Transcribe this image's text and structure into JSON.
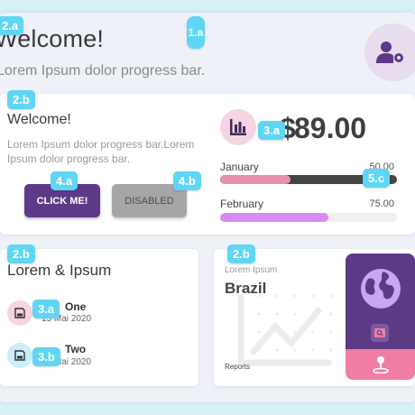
{
  "header": {
    "title": "Welcome!",
    "subtitle": "Lorem Ipsum dolor progress bar.",
    "settings_icon": "user-settings-icon"
  },
  "hero_card": {
    "title": "Welcome!",
    "text": "Lorem Ipsum dolor progress bar.Lorem Ipsum dolor progress bar.",
    "primary_button": "CLICK ME!",
    "disabled_button": "DISABLED"
  },
  "stats": {
    "icon": "bar-chart-icon",
    "amount_prefix": "$",
    "amount": "89.00",
    "bars": [
      {
        "label": "January",
        "value": "50.00",
        "fill": 0.4,
        "color": "#e890ab"
      },
      {
        "label": "February",
        "value": "75.00",
        "fill": 0.61,
        "color": "#d98af0"
      }
    ]
  },
  "list_card": {
    "title": "Lorem & Ipsum",
    "items": [
      {
        "title": "One",
        "date": "15 Mai 2020",
        "icon": "save-icon",
        "color": "#f9d3de"
      },
      {
        "title": "Two",
        "date": "15 Mai 2020",
        "icon": "save-icon",
        "color": "#c9eef8"
      }
    ]
  },
  "location_card": {
    "label": "Lorem Ipsum",
    "title": "Brazil",
    "footer": "Reports",
    "globe_icon": "globe-icon",
    "search_icon": "search-icon",
    "pin_icon": "location-pin-icon"
  },
  "annotations": [
    "1.a",
    "2.a",
    "2.b",
    "2.b",
    "2.b",
    "3.a",
    "3.a",
    "3.b",
    "4.a",
    "4.b",
    "5.c"
  ],
  "colors": {
    "background": "#d6f1f7",
    "primary": "#5e3a86",
    "accent_pink": "#f07ea3",
    "badge": "#5fd6f4"
  }
}
